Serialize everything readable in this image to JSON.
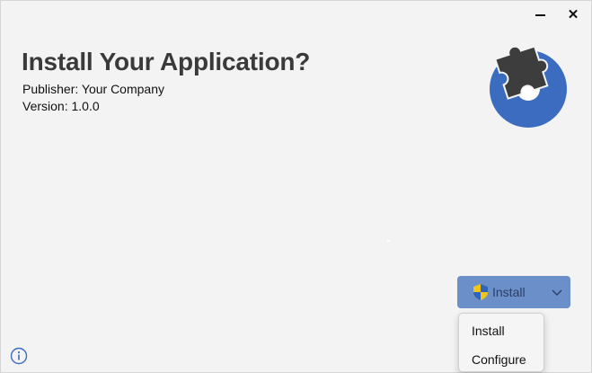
{
  "window": {
    "minimize_label": "",
    "close_label": "✕"
  },
  "header": {
    "title": "Install Your Application?",
    "publisher": "Publisher: Your Company",
    "version": "Version: 1.0.0"
  },
  "install_button": {
    "label": "Install",
    "icon": "uac-shield-icon",
    "dropdown_icon": "chevron-down-icon"
  },
  "dropdown_menu": {
    "items": [
      {
        "label": "Install"
      },
      {
        "label": "Configure"
      }
    ]
  },
  "footer": {
    "info_icon": "info-icon"
  },
  "colors": {
    "background": "#f3f3f3",
    "accent_button": "#6b8fc9",
    "logo_blue": "#3b6cbf",
    "logo_dark": "#3d3d3d"
  }
}
